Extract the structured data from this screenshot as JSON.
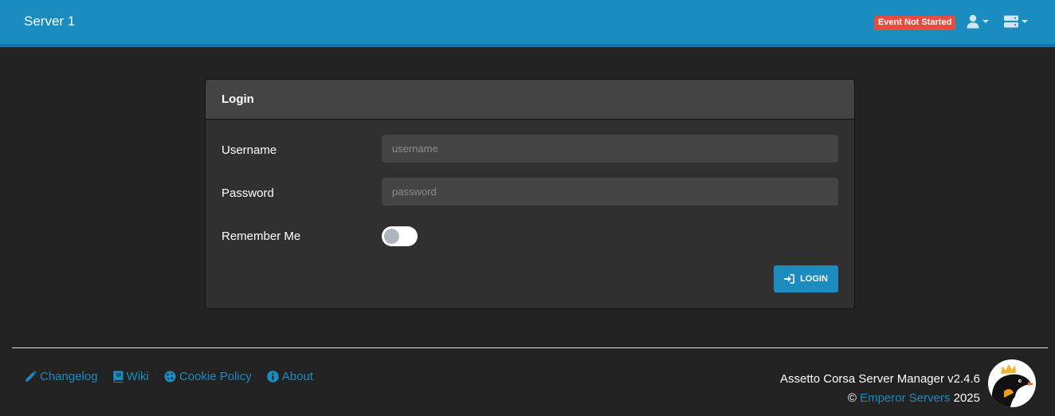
{
  "navbar": {
    "brand": "Server 1",
    "status_badge": "Event Not Started",
    "icons": [
      "user-icon",
      "server-icon"
    ]
  },
  "login_card": {
    "title": "Login",
    "username_label": "Username",
    "username_placeholder": "username",
    "username_value": "",
    "password_label": "Password",
    "password_placeholder": "password",
    "password_value": "",
    "remember_label": "Remember Me",
    "remember_checked": false,
    "login_button": "LOGIN"
  },
  "footer": {
    "links": [
      {
        "label": "Changelog",
        "icon": "pencil-icon"
      },
      {
        "label": "Wiki",
        "icon": "book-icon"
      },
      {
        "label": "Cookie Policy",
        "icon": "cookie-icon"
      },
      {
        "label": "About",
        "icon": "info-icon"
      }
    ],
    "product": "Assetto Corsa Server Manager v2.4.6",
    "copyright_symbol": "©",
    "company": "Emperor Servers",
    "year": "2025"
  },
  "colors": {
    "accent": "#1a8cbf",
    "badge": "#e74c3c",
    "background": "#222222",
    "card": "#303030"
  }
}
